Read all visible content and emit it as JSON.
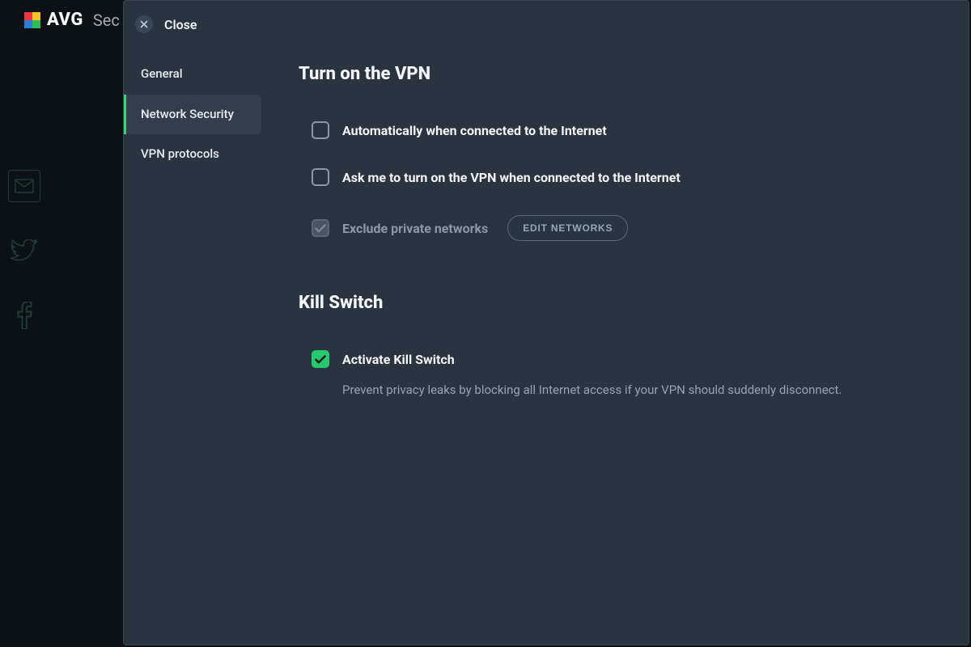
{
  "app": {
    "brand": "AVG",
    "product_partial": "Sec"
  },
  "sidebar": {
    "close_label": "Close",
    "items": [
      {
        "label": "General"
      },
      {
        "label": "Network Security"
      },
      {
        "label": "VPN protocols"
      }
    ]
  },
  "content": {
    "section1_title": "Turn on the VPN",
    "opt_auto": "Automatically when connected to the Internet",
    "opt_ask": "Ask me to turn on the VPN when connected to the Internet",
    "opt_exclude": "Exclude private networks",
    "edit_networks": "EDIT NETWORKS",
    "section2_title": "Kill Switch",
    "opt_killswitch": "Activate Kill Switch",
    "killswitch_desc": "Prevent privacy leaks by blocking all Internet access if your VPN should suddenly disconnect."
  },
  "colors": {
    "accent_green": "#27c96f",
    "panel_bg": "#2a3441"
  },
  "icons": {
    "close": "close-icon",
    "mail": "mail-icon",
    "twitter": "twitter-icon",
    "facebook": "facebook-icon",
    "check": "check-icon"
  }
}
